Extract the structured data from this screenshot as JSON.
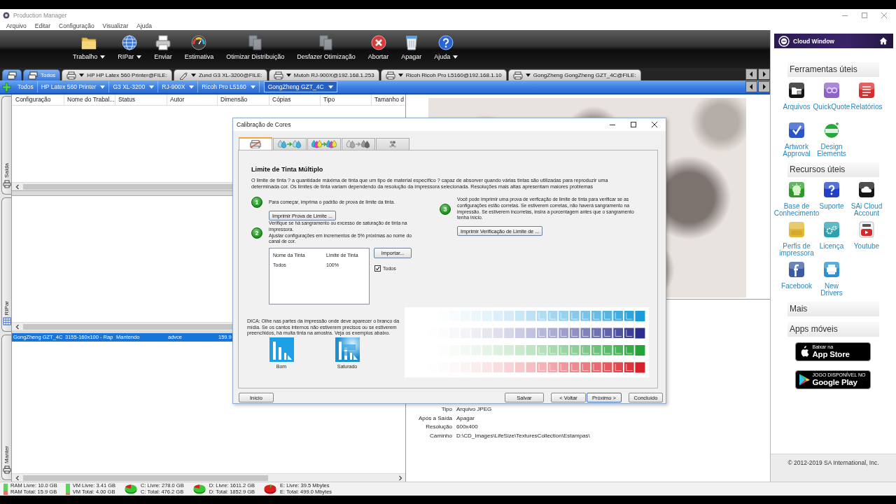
{
  "window": {
    "title": "Production Manager",
    "menu": [
      "Arquivo",
      "Editar",
      "Configuração",
      "Visualizar",
      "Ajuda"
    ]
  },
  "toolbar": [
    {
      "label": "Trabalho",
      "kind": "folder",
      "menu": true,
      "disabled": false
    },
    {
      "label": "RIPar",
      "kind": "globe",
      "menu": true,
      "disabled": false
    },
    {
      "label": "Enviar",
      "kind": "printer",
      "menu": false,
      "disabled": false
    },
    {
      "label": "Estimativa",
      "kind": "gauge",
      "menu": false,
      "disabled": false
    },
    {
      "label": "Otimizar Distribuição",
      "kind": "pages",
      "menu": false,
      "disabled": true
    },
    {
      "label": "Desfazer Otimização",
      "kind": "pages",
      "menu": false,
      "disabled": true
    },
    {
      "label": "Abortar",
      "kind": "abort",
      "menu": false,
      "disabled": false
    },
    {
      "label": "Apagar",
      "kind": "trash",
      "menu": false,
      "disabled": false
    },
    {
      "label": "Ajuda",
      "kind": "help",
      "menu": true,
      "disabled": false
    }
  ],
  "printer_tabs": [
    {
      "kind": "all-icon",
      "selected": true
    },
    {
      "kind": "all",
      "label": "Todos",
      "selected": true
    },
    {
      "kind": "printer",
      "label": "HP HP Latex 560 Printer@FILE:",
      "selected": false
    },
    {
      "kind": "cutter",
      "label": "Zund G3 XL-3200@FILE:",
      "selected": false
    },
    {
      "kind": "printer",
      "label": "Mutoh RJ-900X@192.168.1.253",
      "selected": false
    },
    {
      "kind": "printer",
      "label": "Ricoh Ricoh Pro L5160@192.168.1.10",
      "selected": false
    },
    {
      "kind": "printer",
      "label": "GongZheng GongZheng GZT_4C@FILE:",
      "selected": false
    }
  ],
  "filter_bar": [
    {
      "label": "Todos",
      "menu": false,
      "selected": false
    },
    {
      "label": "HP Latex 560 Printer",
      "menu": true,
      "selected": false
    },
    {
      "label": "G3 XL-3200",
      "menu": true,
      "selected": false
    },
    {
      "label": "RJ-900X",
      "menu": true,
      "selected": false
    },
    {
      "label": "Ricoh Pro L5160",
      "menu": true,
      "selected": false
    },
    {
      "label": "GongZheng GZT_4C",
      "menu": true,
      "selected": true
    }
  ],
  "side_tabs": [
    {
      "label": "Saída",
      "kind": "output"
    },
    {
      "label": "RIPar",
      "kind": "rip"
    },
    {
      "label": "Manter",
      "kind": "hold"
    }
  ],
  "job_list": {
    "columns": [
      "Configuração",
      "Nome do Trabal...",
      "Status",
      "Autor",
      "Dimensão",
      "Cópias",
      "Tipo",
      "Tamanho d"
    ],
    "hold_rows": [
      {
        "cells": [
          "GongZheng GZT_4C",
          "3155-160x100 - Rap",
          "Mantendo",
          "advce",
          "159.9"
        ],
        "selected": true
      }
    ]
  },
  "preview": {
    "properties": [
      {
        "label": "Tipo",
        "value": "Arquivo JPEG"
      },
      {
        "label": "Após a Saída",
        "value": "Apagar"
      },
      {
        "label": "Resolução",
        "value": "600x400"
      },
      {
        "label": "Caminho",
        "value": "D:\\CD_Images\\LifeSize\\TexturesCollection\\Estampas\\"
      }
    ]
  },
  "dialog": {
    "title": "Calibração de Cores",
    "tabs": [
      {
        "kind": "printer",
        "selected": true
      },
      {
        "kind": "cyan",
        "selected": false
      },
      {
        "kind": "cmy",
        "selected": false
      },
      {
        "kind": "gray",
        "selected": false
      },
      {
        "kind": "cluster",
        "selected": false
      }
    ],
    "heading": "Limite de Tinta Múltiplo",
    "intro": "O limite de tinta ? a quantidade máxima de tinta que um tipo de material específico ? capaz de absorver quando várias tintas são utilizadas para reproduzir uma determinada cor. Os limites de tinta variam dependendo da resolução da impressora selecionada. Resoluções mais altas apresentam maiores problemas",
    "steps": [
      {
        "number": "1",
        "texts": [
          "Para começar, imprima o padrão de prova de limite da tinta."
        ],
        "button": "Imprimir Prova de Limite ..."
      },
      {
        "number": "2",
        "texts": [
          "Verifique se há sangramento ou excesso de saturação de tinta na impressora.",
          "Ajustar configurações em incrementos de 5% próximas ao nome do canal de cor."
        ]
      },
      {
        "number": "3",
        "texts": [
          "Você pode imprimir uma prova de verficação de limite de tinta para verificar se as configurações estão corretas. Se estiverem corretas, não haverá sangramento na impressão. Se estiverem incorretas, insira a porcentagem antes que o sangramento tenha início."
        ],
        "button": "Imprimir Verificação de Limite de ..."
      }
    ],
    "ink_table": {
      "columns": [
        "Nome da Tinta",
        "Limite de Tinta"
      ],
      "rows": [
        [
          "Todos",
          "100%"
        ]
      ]
    },
    "import_button": "Importar...",
    "all_inks": {
      "label": "Todos",
      "checked": true
    },
    "tip": "DICA: Olhe nas partes da impressão onde deve aparecer o branco da mídia. Se os cantos internos não estiverem precisos ou se estiverem preenchidos, há muita tinta na amostra. Veja os exemplos abaixo.",
    "examples": [
      {
        "kind": "good",
        "label": "Bom"
      },
      {
        "kind": "saturated",
        "label": "Saturado"
      }
    ],
    "sample_rows": [
      {
        "color": "#1c9bd7"
      },
      {
        "color": "#2a2e8c"
      },
      {
        "color": "#24a339"
      },
      {
        "color": "#d9202a"
      }
    ],
    "buttons": [
      "Início",
      "Salvar",
      "< Voltar",
      "Próximo >",
      "Concluído"
    ]
  },
  "cloud_window": {
    "title": "Cloud Window",
    "sections": [
      {
        "title": "Ferramentas úteis",
        "links": [
          {
            "kind": "files",
            "lines": [
              "Arquivos"
            ]
          },
          {
            "kind": "quote",
            "lines": [
              "QuickQuote"
            ]
          },
          {
            "kind": "reports",
            "lines": [
              "Relatórios"
            ]
          },
          {
            "kind": "approval",
            "lines": [
              "Artwork",
              "Approval"
            ]
          },
          {
            "kind": "design",
            "lines": [
              "Design",
              "Elements"
            ]
          }
        ]
      },
      {
        "title": "Recursos úteis",
        "links": [
          {
            "kind": "knowledge",
            "lines": [
              "Base de",
              "Conhecimento"
            ]
          },
          {
            "kind": "support",
            "lines": [
              "Suporte"
            ]
          },
          {
            "kind": "cloud",
            "lines": [
              "SAi Cloud",
              "Account"
            ]
          },
          {
            "kind": "profiles",
            "lines": [
              "Perfis de",
              "impressora"
            ]
          },
          {
            "kind": "license",
            "lines": [
              "Licença"
            ]
          },
          {
            "kind": "youtube",
            "lines": [
              "Youtube"
            ]
          },
          {
            "kind": "facebook",
            "lines": [
              "Facebook"
            ]
          },
          {
            "kind": "drivers",
            "lines": [
              "New",
              "Drivers"
            ]
          }
        ]
      },
      {
        "title": "Mais"
      },
      {
        "title": "Apps móveis",
        "badges": [
          {
            "kind": "apple",
            "caption": "Baixar na",
            "store": "App Store"
          },
          {
            "kind": "google",
            "caption": "JOGO DISPONÍVEL NO",
            "store": "Google Play"
          }
        ]
      }
    ],
    "copyright": "© 2012-2019 SA International, Inc."
  },
  "status_bar": [
    {
      "kind": "memory",
      "lines": [
        "RAM Livre: 10.0 GB",
        "RAM Total: 15.9 GB"
      ],
      "level": 0.37
    },
    {
      "kind": "memory",
      "lines": [
        "VM Livre: 3.41 GB",
        "VM Total: 4.00 GB"
      ],
      "level": 0.15
    },
    {
      "kind": "disk",
      "lines": [
        "C: Livre: 278.0 GB",
        "C: Total: 476.2 GB"
      ],
      "low_space": false
    },
    {
      "kind": "disk",
      "lines": [
        "D: Livre: 1611.2 GB",
        "D: Total: 1852.9 GB"
      ],
      "low_space": false
    },
    {
      "kind": "disk",
      "lines": [
        "E: Livre: 39.5 Mbytes",
        "E: Total: 499.0 Mbytes"
      ],
      "low_space": true
    }
  ]
}
